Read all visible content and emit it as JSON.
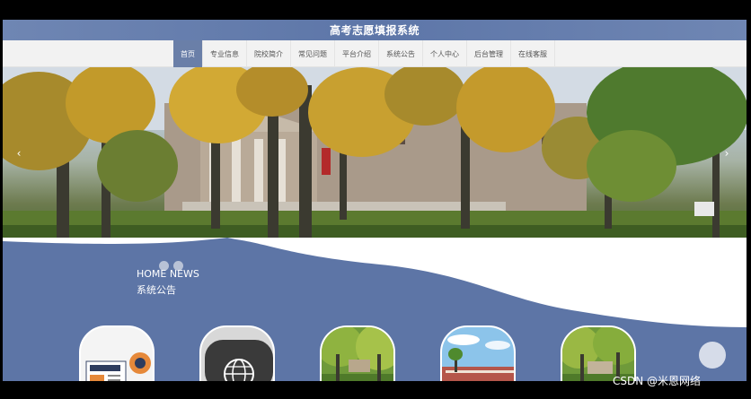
{
  "app": {
    "title": "高考志愿填报系统"
  },
  "nav": {
    "items": [
      {
        "label": "首页",
        "active": true
      },
      {
        "label": "专业信息",
        "active": false
      },
      {
        "label": "院校简介",
        "active": false
      },
      {
        "label": "常见问题",
        "active": false
      },
      {
        "label": "平台介绍",
        "active": false
      },
      {
        "label": "系统公告",
        "active": false
      },
      {
        "label": "个人中心",
        "active": false
      },
      {
        "label": "后台管理",
        "active": false
      },
      {
        "label": "在线客服",
        "active": false
      }
    ]
  },
  "banner": {
    "prev_icon": "chevron-left-icon",
    "next_icon": "chevron-right-icon"
  },
  "news": {
    "heading_en": "HOME NEWS",
    "heading_cn": "系统公告",
    "cards": [
      {
        "kind": "news-paper"
      },
      {
        "kind": "news-globe"
      },
      {
        "kind": "campus-photo"
      },
      {
        "kind": "building-photo"
      },
      {
        "kind": "campus-photo"
      }
    ]
  },
  "watermark": "CSDN @米恩网络",
  "colors": {
    "accent": "#5d75a6",
    "nav_active": "#6a7fa8",
    "title_bar": "#6f86b3"
  }
}
